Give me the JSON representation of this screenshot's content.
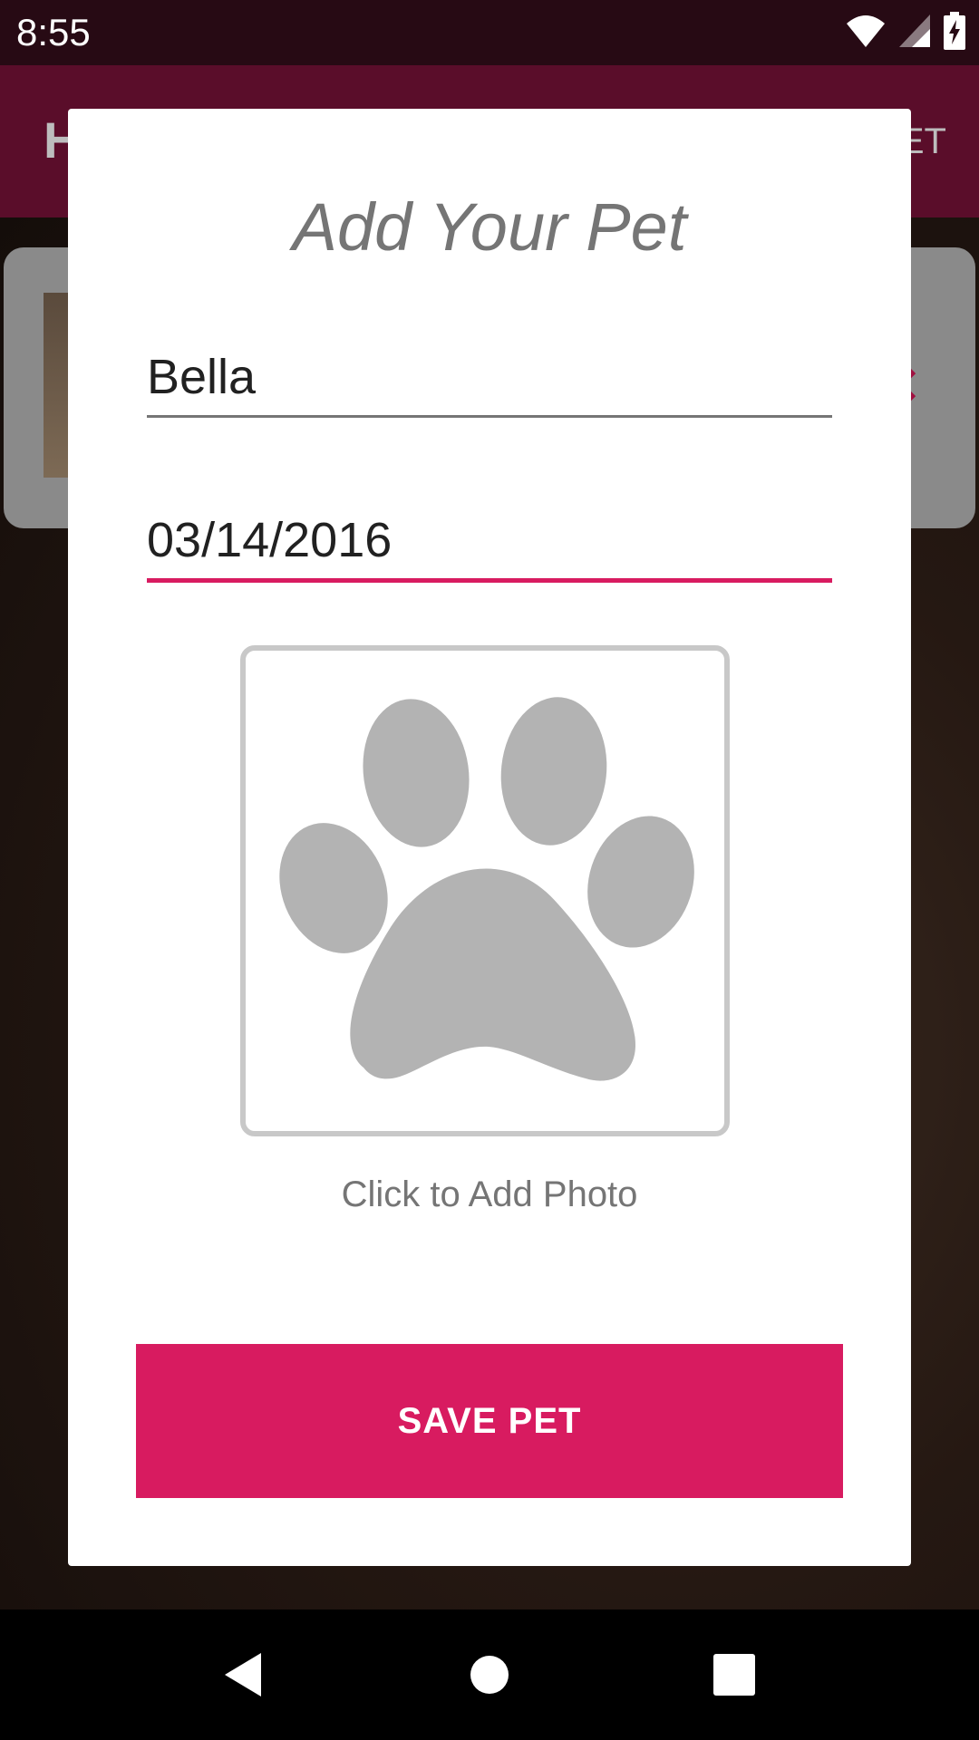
{
  "status_bar": {
    "time": "8:55"
  },
  "app_bar": {
    "title_partial": "H",
    "action_partial": "ET"
  },
  "dialog": {
    "title": "Add Your Pet",
    "name_value": "Bella",
    "date_value": "03/14/2016",
    "photo_caption": "Click to Add Photo",
    "save_label": "SAVE PET"
  },
  "colors": {
    "accent": "#d81b60",
    "app_bar": "#5a0d2a",
    "status_bar": "#270a14",
    "paw": "#b3b3b3"
  },
  "icons": {
    "photo_placeholder": "paw-icon",
    "status": [
      "wifi-icon",
      "signal-icon",
      "battery-charging-icon"
    ],
    "nav": [
      "back-icon",
      "home-icon",
      "recents-icon"
    ]
  }
}
